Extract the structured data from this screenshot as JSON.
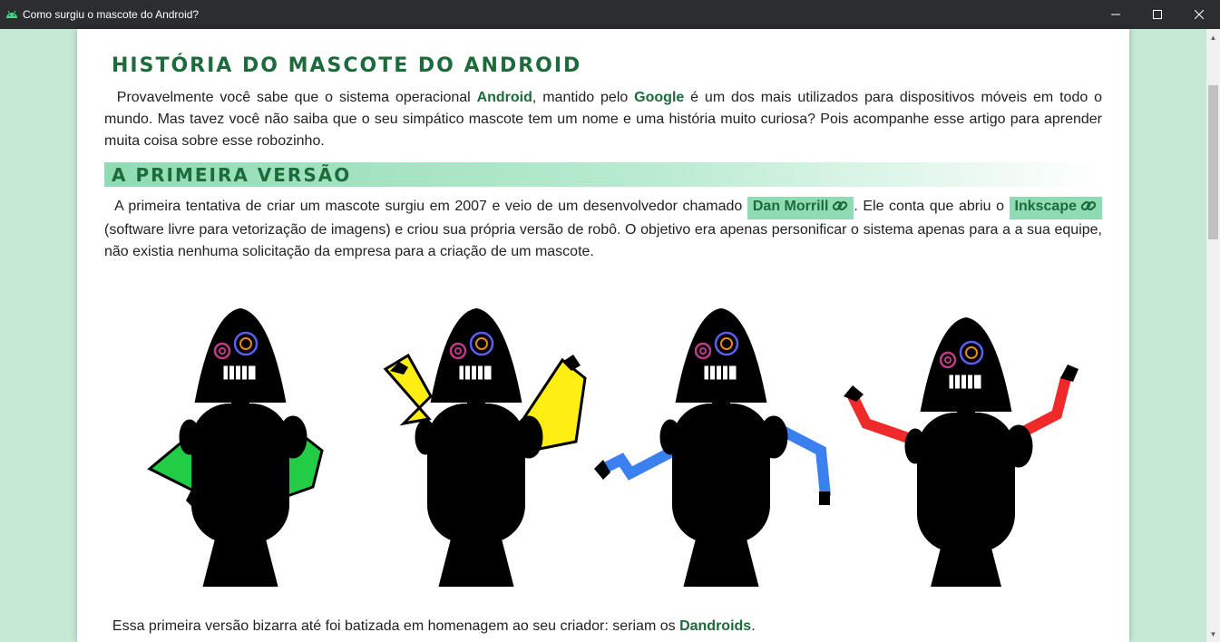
{
  "window": {
    "title": "Como surgiu o mascote do Android?",
    "controls": [
      "minimize-icon",
      "maximize-icon",
      "close-icon"
    ]
  },
  "article": {
    "title": "História do mascote do Android",
    "intro": {
      "t1": "Provavelmente você sabe que o sistema operacional ",
      "android": "Android",
      "t2": ", mantido pelo ",
      "google": "Google",
      "t3": " é um dos mais utilizados para dispositivos móveis em todo o mundo. Mas tavez você não saiba que o seu simpático mascote tem um nome e uma história muito curiosa? Pois acompanhe esse artigo para aprender muita coisa sobre esse robozinho."
    },
    "section1": {
      "heading": "A primeira versão",
      "p": {
        "t1": "A primeira tentativa de criar um mascote surgiu em 2007 e veio de um desenvolvedor chamado ",
        "link1": "Dan Morrill",
        "t2": ". Ele conta que abriu o ",
        "link2": "Inkscape",
        "t3": " (software livre para vetorização de imagens) e criou sua própria versão de robô. O objetivo era apenas personificar o sistema apenas para a a sua equipe, não existia nenhuma solicitação da empresa para a criação de um mascote."
      },
      "p2": {
        "t1": "Essa primeira versão bizarra até foi batizada em homenagem ao seu criador: seriam os ",
        "dandroids": "Dandroids",
        "t2": "."
      }
    },
    "robots": [
      {
        "name": "green-robot",
        "body": "#22cc44",
        "inner": "#11a033"
      },
      {
        "name": "yellow-robot",
        "body": "#ffee11",
        "inner": "#f2d400"
      },
      {
        "name": "blue-robot",
        "body": "#3a80f0",
        "inner": "#2555d8"
      },
      {
        "name": "red-robot",
        "body": "#f02a2a",
        "inner": "#d0221e"
      }
    ]
  },
  "colors": {
    "background": "#c5e9d5",
    "heading": "#1d6b3a",
    "highlight": "#8fdbb4",
    "titlebar": "#2b2d31"
  }
}
